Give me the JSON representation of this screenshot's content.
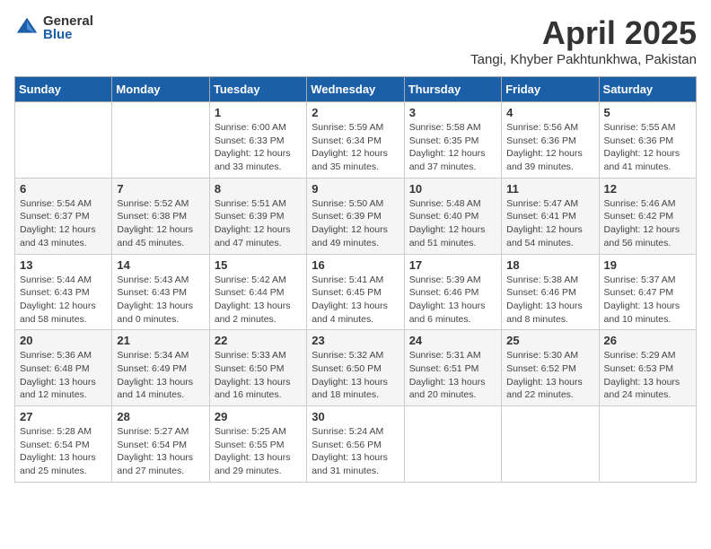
{
  "header": {
    "logo_general": "General",
    "logo_blue": "Blue",
    "month": "April 2025",
    "location": "Tangi, Khyber Pakhtunkhwa, Pakistan"
  },
  "days_of_week": [
    "Sunday",
    "Monday",
    "Tuesday",
    "Wednesday",
    "Thursday",
    "Friday",
    "Saturday"
  ],
  "weeks": [
    [
      {
        "day": "",
        "detail": ""
      },
      {
        "day": "",
        "detail": ""
      },
      {
        "day": "1",
        "detail": "Sunrise: 6:00 AM\nSunset: 6:33 PM\nDaylight: 12 hours and 33 minutes."
      },
      {
        "day": "2",
        "detail": "Sunrise: 5:59 AM\nSunset: 6:34 PM\nDaylight: 12 hours and 35 minutes."
      },
      {
        "day": "3",
        "detail": "Sunrise: 5:58 AM\nSunset: 6:35 PM\nDaylight: 12 hours and 37 minutes."
      },
      {
        "day": "4",
        "detail": "Sunrise: 5:56 AM\nSunset: 6:36 PM\nDaylight: 12 hours and 39 minutes."
      },
      {
        "day": "5",
        "detail": "Sunrise: 5:55 AM\nSunset: 6:36 PM\nDaylight: 12 hours and 41 minutes."
      }
    ],
    [
      {
        "day": "6",
        "detail": "Sunrise: 5:54 AM\nSunset: 6:37 PM\nDaylight: 12 hours and 43 minutes."
      },
      {
        "day": "7",
        "detail": "Sunrise: 5:52 AM\nSunset: 6:38 PM\nDaylight: 12 hours and 45 minutes."
      },
      {
        "day": "8",
        "detail": "Sunrise: 5:51 AM\nSunset: 6:39 PM\nDaylight: 12 hours and 47 minutes."
      },
      {
        "day": "9",
        "detail": "Sunrise: 5:50 AM\nSunset: 6:39 PM\nDaylight: 12 hours and 49 minutes."
      },
      {
        "day": "10",
        "detail": "Sunrise: 5:48 AM\nSunset: 6:40 PM\nDaylight: 12 hours and 51 minutes."
      },
      {
        "day": "11",
        "detail": "Sunrise: 5:47 AM\nSunset: 6:41 PM\nDaylight: 12 hours and 54 minutes."
      },
      {
        "day": "12",
        "detail": "Sunrise: 5:46 AM\nSunset: 6:42 PM\nDaylight: 12 hours and 56 minutes."
      }
    ],
    [
      {
        "day": "13",
        "detail": "Sunrise: 5:44 AM\nSunset: 6:43 PM\nDaylight: 12 hours and 58 minutes."
      },
      {
        "day": "14",
        "detail": "Sunrise: 5:43 AM\nSunset: 6:43 PM\nDaylight: 13 hours and 0 minutes."
      },
      {
        "day": "15",
        "detail": "Sunrise: 5:42 AM\nSunset: 6:44 PM\nDaylight: 13 hours and 2 minutes."
      },
      {
        "day": "16",
        "detail": "Sunrise: 5:41 AM\nSunset: 6:45 PM\nDaylight: 13 hours and 4 minutes."
      },
      {
        "day": "17",
        "detail": "Sunrise: 5:39 AM\nSunset: 6:46 PM\nDaylight: 13 hours and 6 minutes."
      },
      {
        "day": "18",
        "detail": "Sunrise: 5:38 AM\nSunset: 6:46 PM\nDaylight: 13 hours and 8 minutes."
      },
      {
        "day": "19",
        "detail": "Sunrise: 5:37 AM\nSunset: 6:47 PM\nDaylight: 13 hours and 10 minutes."
      }
    ],
    [
      {
        "day": "20",
        "detail": "Sunrise: 5:36 AM\nSunset: 6:48 PM\nDaylight: 13 hours and 12 minutes."
      },
      {
        "day": "21",
        "detail": "Sunrise: 5:34 AM\nSunset: 6:49 PM\nDaylight: 13 hours and 14 minutes."
      },
      {
        "day": "22",
        "detail": "Sunrise: 5:33 AM\nSunset: 6:50 PM\nDaylight: 13 hours and 16 minutes."
      },
      {
        "day": "23",
        "detail": "Sunrise: 5:32 AM\nSunset: 6:50 PM\nDaylight: 13 hours and 18 minutes."
      },
      {
        "day": "24",
        "detail": "Sunrise: 5:31 AM\nSunset: 6:51 PM\nDaylight: 13 hours and 20 minutes."
      },
      {
        "day": "25",
        "detail": "Sunrise: 5:30 AM\nSunset: 6:52 PM\nDaylight: 13 hours and 22 minutes."
      },
      {
        "day": "26",
        "detail": "Sunrise: 5:29 AM\nSunset: 6:53 PM\nDaylight: 13 hours and 24 minutes."
      }
    ],
    [
      {
        "day": "27",
        "detail": "Sunrise: 5:28 AM\nSunset: 6:54 PM\nDaylight: 13 hours and 25 minutes."
      },
      {
        "day": "28",
        "detail": "Sunrise: 5:27 AM\nSunset: 6:54 PM\nDaylight: 13 hours and 27 minutes."
      },
      {
        "day": "29",
        "detail": "Sunrise: 5:25 AM\nSunset: 6:55 PM\nDaylight: 13 hours and 29 minutes."
      },
      {
        "day": "30",
        "detail": "Sunrise: 5:24 AM\nSunset: 6:56 PM\nDaylight: 13 hours and 31 minutes."
      },
      {
        "day": "",
        "detail": ""
      },
      {
        "day": "",
        "detail": ""
      },
      {
        "day": "",
        "detail": ""
      }
    ]
  ]
}
